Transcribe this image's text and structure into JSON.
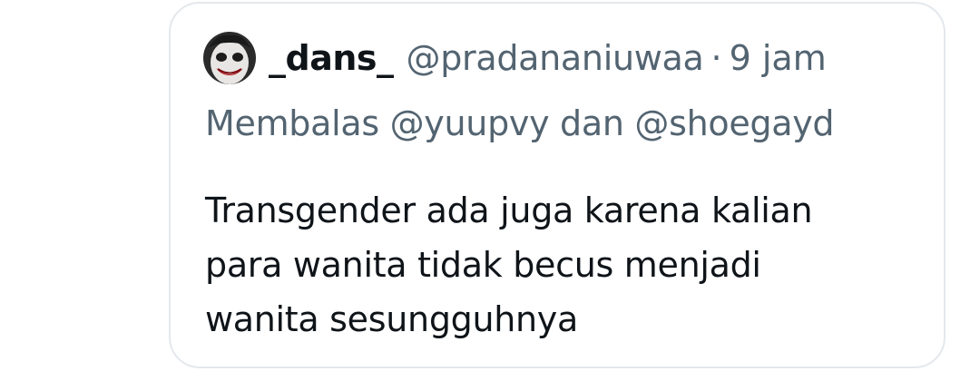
{
  "tweet": {
    "author": {
      "display_name": "_dans_",
      "handle": "@pradananiuwaa",
      "avatar_icon": "joker-face-avatar"
    },
    "separator": "·",
    "time": "9 jam",
    "replying_to": "Membalas @yuupvy dan @shoegayd",
    "text_lines": [
      "Transgender ada juga karena kalian",
      "para wanita tidak becus menjadi",
      "wanita sesungguhnya"
    ]
  },
  "colors": {
    "text_primary": "#0f1419",
    "text_secondary": "#536471",
    "card_border": "#e4e8ec",
    "background": "#ffffff"
  }
}
